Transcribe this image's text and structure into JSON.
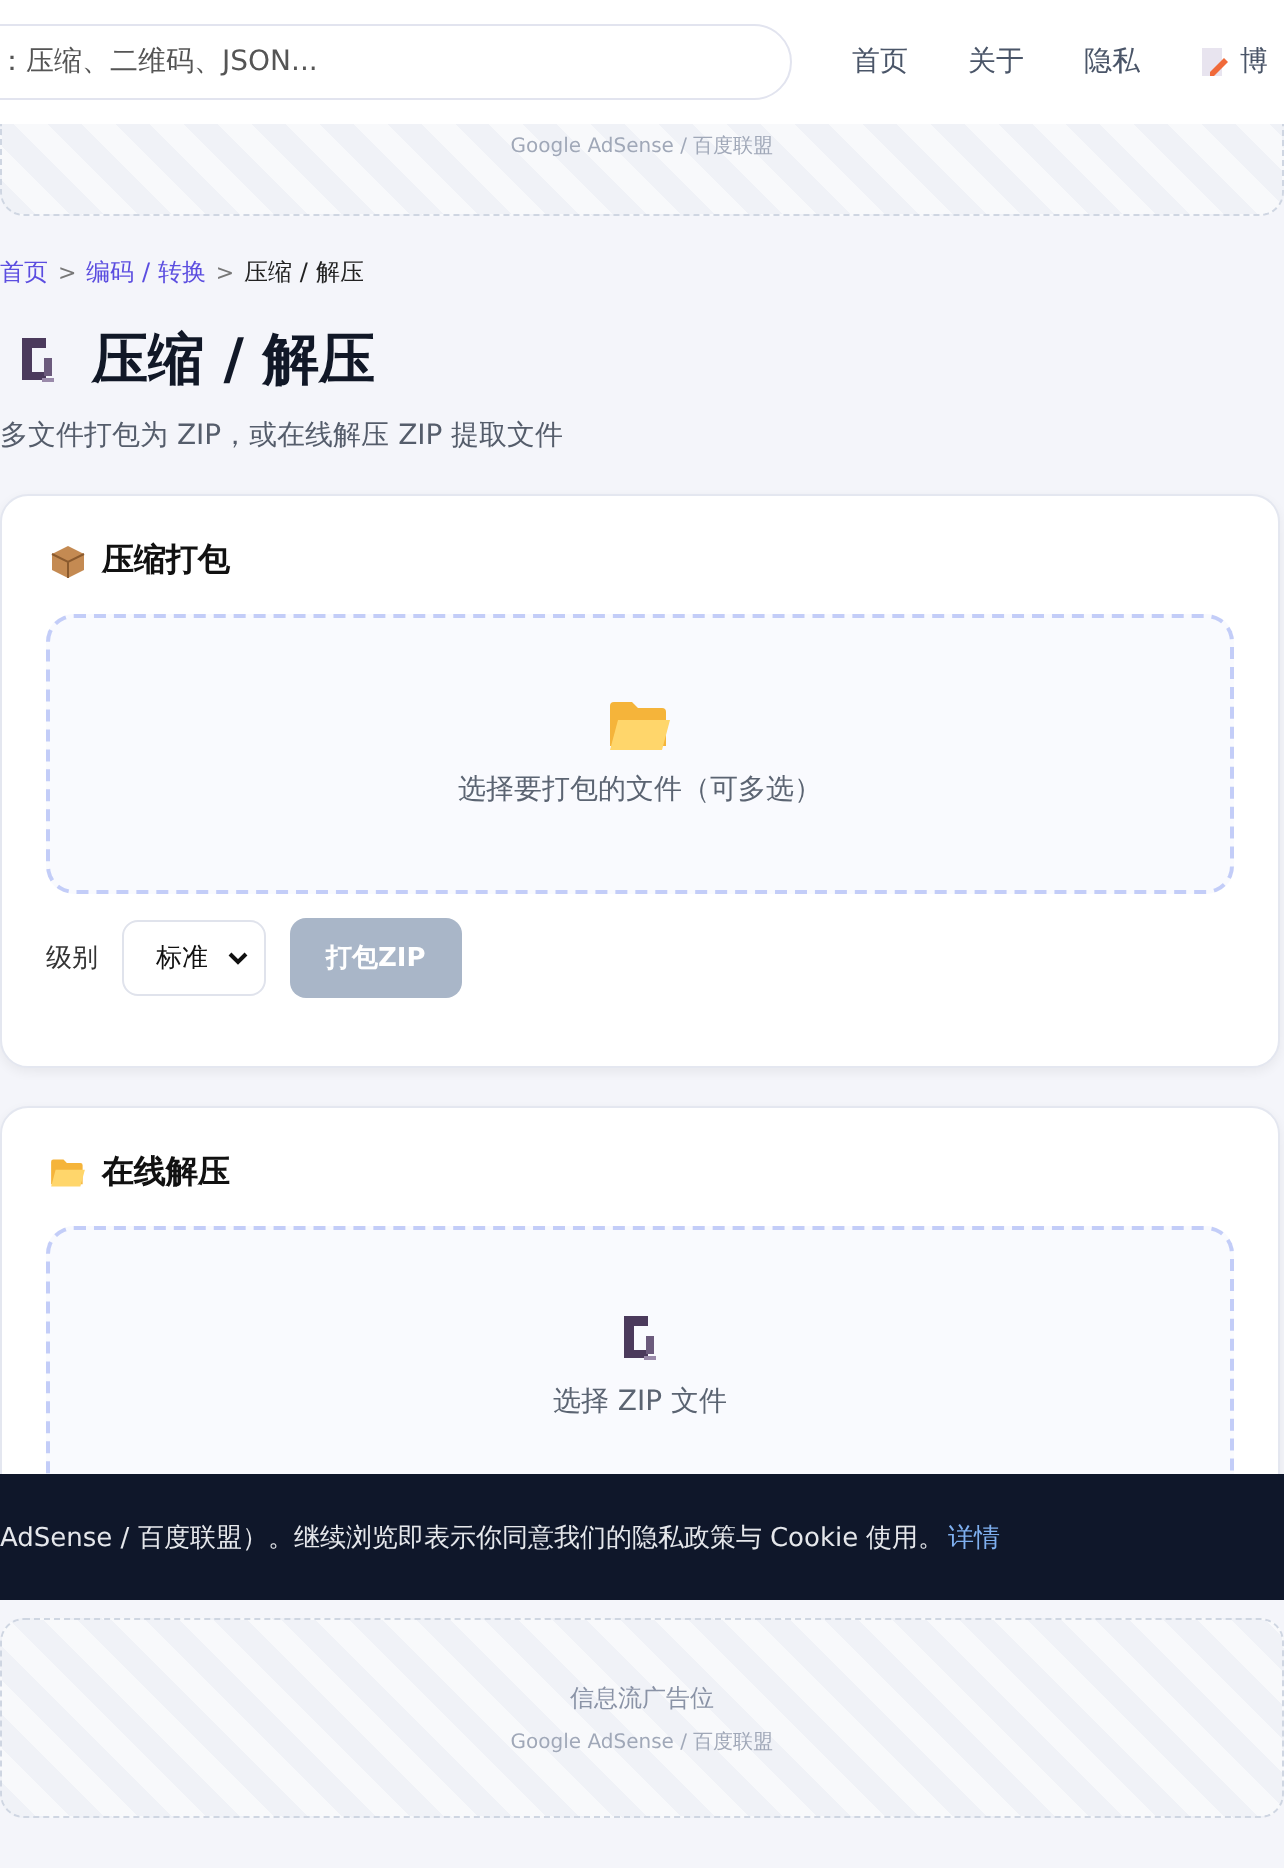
{
  "header": {
    "search": {
      "placeholder": "：压缩、二维码、JSON..."
    },
    "nav": [
      {
        "label": "首页",
        "kind": "text"
      },
      {
        "label": "关于",
        "kind": "text"
      },
      {
        "label": "隐私",
        "kind": "text"
      },
      {
        "label": "博",
        "kind": "icon"
      }
    ]
  },
  "top_ad": {
    "caption": "Google AdSense / 百度联盟"
  },
  "breadcrumb_separator": ">",
  "breadcrumb": [
    {
      "label": "首页",
      "link": true
    },
    {
      "label": "编码 / 转换",
      "link": true
    },
    {
      "label": "压缩 / 解压",
      "link": false
    }
  ],
  "title": "压缩 / 解压",
  "subtitle": "多文件打包为 ZIP，或在线解压 ZIP 提取文件",
  "pack_card": {
    "heading": "压缩打包",
    "dropzone": "选择要打包的文件（可多选）",
    "level_label": "级别",
    "level_value": "标准",
    "button": {
      "label": "打包ZIP",
      "disabled": true
    }
  },
  "unzip_card": {
    "heading": "在线解压",
    "dropzone": "选择 ZIP 文件"
  },
  "cookie_banner": {
    "text": "AdSense / 百度联盟）。继续浏览即表示你同意我们的隐私政策与 Cookie 使用。",
    "link": "详情"
  },
  "feed_ad": {
    "title": "信息流广告位",
    "caption": "Google AdSense / 百度联盟"
  }
}
